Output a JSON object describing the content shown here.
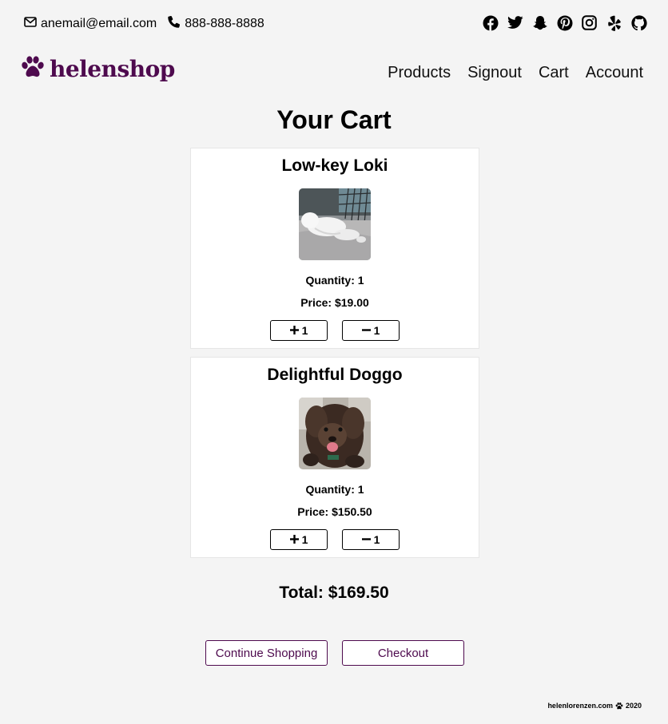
{
  "header": {
    "email": "anemail@email.com",
    "phone": "888-888-8888",
    "socials": [
      "facebook-icon",
      "twitter-icon",
      "snapchat-icon",
      "pinterest-icon",
      "instagram-icon",
      "yelp-icon",
      "github-icon"
    ]
  },
  "brand": {
    "name": "helenshop",
    "color": "#4e0a4e"
  },
  "nav": {
    "items": [
      {
        "label": "Products"
      },
      {
        "label": "Signout"
      },
      {
        "label": "Cart"
      },
      {
        "label": "Account"
      }
    ]
  },
  "cart": {
    "title": "Your Cart",
    "items": [
      {
        "name": "Low-key Loki",
        "quantity": "Quantity: 1",
        "price": "Price: $19.00",
        "plus_label": "1",
        "minus_label": "1"
      },
      {
        "name": "Delightful Doggo",
        "quantity": "Quantity: 1",
        "price": "Price: $150.50",
        "plus_label": "1",
        "minus_label": "1"
      }
    ],
    "total": "Total: $169.50"
  },
  "actions": {
    "continue_label": "Continue Shopping",
    "checkout_label": "Checkout"
  },
  "footer": {
    "site": "helenlorenzen.com",
    "year": "2020"
  }
}
